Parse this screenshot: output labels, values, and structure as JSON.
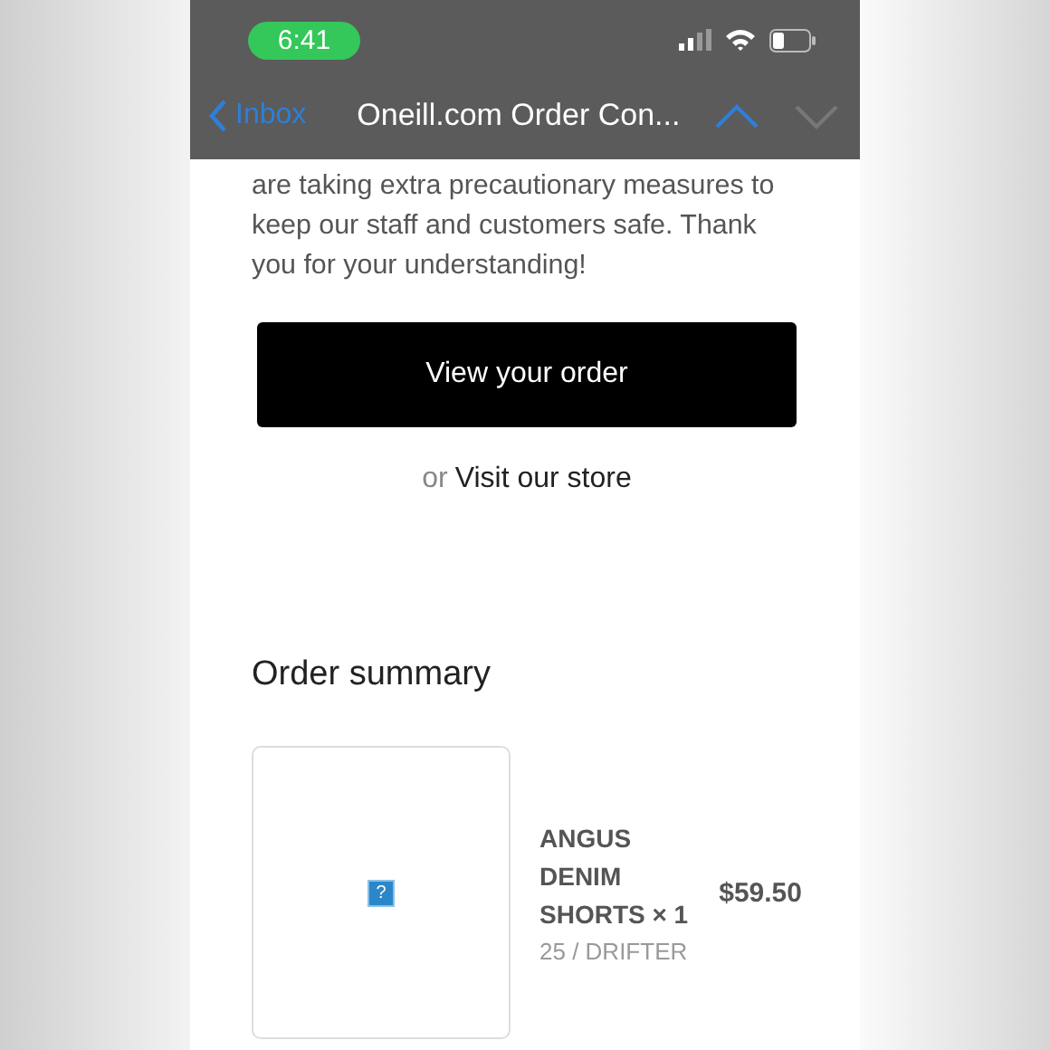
{
  "status_bar": {
    "time": "6:41"
  },
  "nav": {
    "back": "Inbox",
    "title": "Oneill.com Order Con...",
    "previous_disabled": false,
    "next_disabled": true
  },
  "body_text": "are taking extra precautionary measures to keep our staff and customers safe. Thank you for your understanding!",
  "view_order_button": "View your order",
  "store_link": {
    "prefix": "or",
    "link": "Visit our store"
  },
  "order_summary": {
    "title": "Order summary",
    "items": [
      {
        "image_placeholder": "?",
        "name": "ANGUS DENIM SHORTS × 1",
        "variant": "25 / DRIFTER",
        "price": "$59.50"
      }
    ]
  }
}
